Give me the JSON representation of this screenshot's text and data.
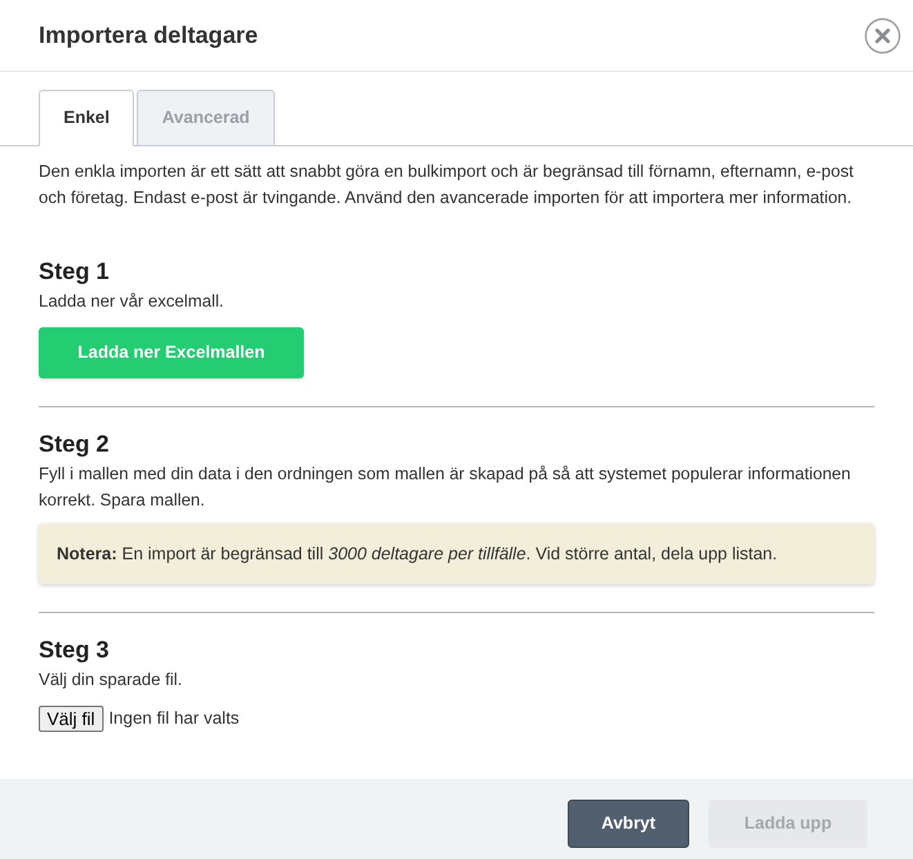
{
  "dialog": {
    "title": "Importera deltagare"
  },
  "tabs": [
    {
      "label": "Enkel",
      "selected": true
    },
    {
      "label": "Avancerad",
      "selected": false
    }
  ],
  "intro": "Den enkla importen är ett sätt att snabbt göra en bulkimport och är begränsad till förnamn, efternamn, e-post och företag. Endast e-post är tvingande. Använd den avancerade importen för att importera mer information.",
  "steps": [
    {
      "kind": "download",
      "title": "Steg 1",
      "text": "Ladda ner vår excelmall.",
      "button": "Ladda ner Excelmallen"
    },
    {
      "kind": "note",
      "title": "Steg 2",
      "text": "Fyll i mallen med din data i den ordningen som mallen är skapad på så att systemet populerar informationen korrekt. Spara mallen.",
      "note": "**Notera:** En import är begränsad till *3000 deltagare per tillfälle*. Vid större antal, dela upp listan."
    },
    {
      "kind": "file",
      "title": "Steg 3",
      "text": "Välj din sparade fil.",
      "file_button": "Välj fil",
      "file_status": "Ingen fil har valts"
    }
  ],
  "footer": {
    "buttons": [
      {
        "label": "Avbryt",
        "kind": "secondary",
        "disabled": false
      },
      {
        "label": "Ladda upp",
        "kind": "primary",
        "disabled": true
      }
    ]
  }
}
